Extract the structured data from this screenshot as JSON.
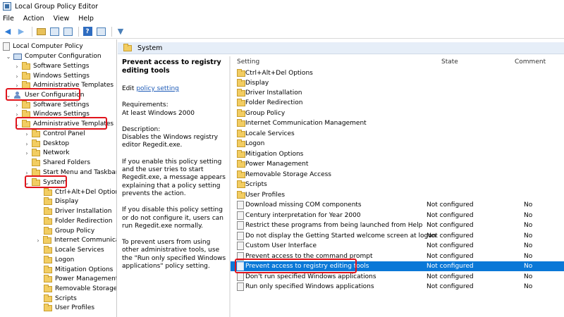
{
  "window": {
    "title": "Local Group Policy Editor"
  },
  "menu": [
    "File",
    "Action",
    "View",
    "Help"
  ],
  "toolbar": {
    "help_label": "?"
  },
  "tree": {
    "root": "Local Computer Policy",
    "computer_configuration": "Computer Configuration",
    "cc_children": [
      "Software Settings",
      "Windows Settings",
      "Administrative Templates"
    ],
    "user_configuration": "User Configuration",
    "uc_children": [
      "Software Settings",
      "Windows Settings",
      "Administrative Templates"
    ],
    "admin_children": [
      "Control Panel",
      "Desktop",
      "Network",
      "Shared Folders",
      "Start Menu and Taskbar",
      "System"
    ],
    "system_children": [
      "Ctrl+Alt+Del Options",
      "Display",
      "Driver Installation",
      "Folder Redirection",
      "Group Policy",
      "Internet Communicati",
      "Locale Services",
      "Logon",
      "Mitigation Options",
      "Power Management",
      "Removable Storage A",
      "Scripts",
      "User Profiles"
    ]
  },
  "section": {
    "title": "System"
  },
  "description": {
    "title": "Prevent access to registry editing tools",
    "edit_prefix": "Edit",
    "edit_link": "policy setting",
    "requirements_label": "Requirements:",
    "requirements_value": "At least Windows 2000",
    "description_label": "Description:",
    "description_text": "Disables the Windows registry editor Regedit.exe.",
    "para_enable": "If you enable this policy setting and the user tries to start Regedit.exe, a message appears explaining that a policy setting prevents the action.",
    "para_disable": "If you disable this policy setting or do not configure it, users can run Regedit.exe normally.",
    "para_prevent": "To prevent users from using other administrative tools, use the \"Run only specified Windows applications\" policy setting."
  },
  "list": {
    "columns": {
      "setting": "Setting",
      "state": "State",
      "comment": "Comment"
    },
    "folders": [
      "Ctrl+Alt+Del Options",
      "Display",
      "Driver Installation",
      "Folder Redirection",
      "Group Policy",
      "Internet Communication Management",
      "Locale Services",
      "Logon",
      "Mitigation Options",
      "Power Management",
      "Removable Storage Access",
      "Scripts",
      "User Profiles"
    ],
    "policies": [
      {
        "name": "Download missing COM components",
        "state": "Not configured",
        "comment": "No"
      },
      {
        "name": "Century interpretation for Year 2000",
        "state": "Not configured",
        "comment": "No"
      },
      {
        "name": "Restrict these programs from being launched from Help",
        "state": "Not configured",
        "comment": "No"
      },
      {
        "name": "Do not display the Getting Started welcome screen at logon",
        "state": "Not configured",
        "comment": "No"
      },
      {
        "name": "Custom User Interface",
        "state": "Not configured",
        "comment": "No"
      },
      {
        "name": "Prevent access to the command prompt",
        "state": "Not configured",
        "comment": "No"
      },
      {
        "name": "Prevent access to registry editing tools",
        "state": "Not configured",
        "comment": "No"
      },
      {
        "name": "Don't run specified Windows applications",
        "state": "Not configured",
        "comment": "No"
      },
      {
        "name": "Run only specified Windows applications",
        "state": "Not configured",
        "comment": "No"
      }
    ]
  },
  "colors": {
    "selection": "#0a78d7",
    "highlight_box": "#e0141c",
    "header_bg": "#e6eef8"
  }
}
